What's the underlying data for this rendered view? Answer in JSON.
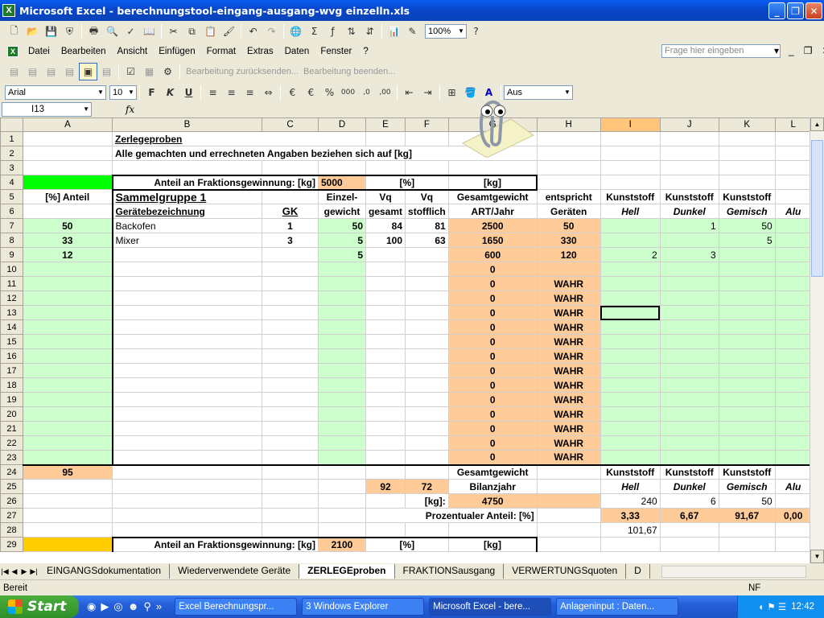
{
  "window": {
    "title": "Microsoft Excel - berechnungstool-eingang-ausgang-wvg einzelln.xls"
  },
  "menu": [
    "Datei",
    "Bearbeiten",
    "Ansicht",
    "Einfügen",
    "Format",
    "Extras",
    "Daten",
    "Fenster",
    "?"
  ],
  "help_placeholder": "Frage hier eingeben",
  "standard_toolbar": {
    "zoom": "100%",
    "icons": [
      "new-icon",
      "open-icon",
      "save-icon",
      "permission-icon",
      "print-icon",
      "print-preview-icon",
      "spelling-icon",
      "research-icon",
      "cut-icon",
      "copy-icon",
      "paste-icon",
      "format-painter-icon",
      "undo-icon",
      "redo-icon",
      "hyperlink-icon",
      "autosum-icon",
      "sort-asc-icon",
      "sort-desc-icon",
      "chart-wizard-icon",
      "drawing-icon",
      "zoom-icon",
      "help-icon"
    ]
  },
  "review_toolbar": {
    "reply_label": "Bearbeitung zurücksenden...",
    "end_label": "Bearbeitung beenden..."
  },
  "formatting_toolbar": {
    "font": "Arial",
    "size": "10",
    "border_style": "Aus"
  },
  "formula_bar": {
    "name_box": "I13",
    "fx": "fx",
    "value": ""
  },
  "columns": [
    "A",
    "B",
    "C",
    "D",
    "E",
    "F",
    "G",
    "H",
    "I",
    "J",
    "K",
    "L"
  ],
  "sheet": {
    "title": "Zerlegeproben",
    "subtitle": "Alle gemachten und errechneten Angaben beziehen sich auf [kg]",
    "r4": {
      "label": "Anteil an Fraktionsgewinnung: [kg]",
      "value": "5000",
      "pct": "[%]",
      "kg": "[kg]"
    },
    "r5": {
      "a": "[%] Anteil",
      "b": "Sammelgruppe 1",
      "d": "Einzel-",
      "e": "Vq",
      "f": "Vq",
      "g": "Gesamtgewicht",
      "h": "entspricht",
      "i": "Kunststoff",
      "j": "Kunststoff",
      "k": "Kunststoff"
    },
    "r6": {
      "b": "Gerätebezeichnung",
      "c": "GK",
      "d": "gewicht",
      "e": "gesamt",
      "f": "stofflich",
      "g": "ART/Jahr",
      "h": "Geräten",
      "i": "Hell",
      "j": "Dunkel",
      "k": "Gemisch",
      "l": "Alu"
    },
    "rows": [
      {
        "n": "7",
        "a": "50",
        "b": "Backofen",
        "c": "1",
        "d": "50",
        "e": "84",
        "f": "81",
        "g": "2500",
        "h": "50",
        "i": "",
        "j": "1",
        "k": "50"
      },
      {
        "n": "8",
        "a": "33",
        "b": "Mixer",
        "c": "3",
        "d": "5",
        "e": "100",
        "f": "63",
        "g": "1650",
        "h": "330",
        "i": "",
        "j": "",
        "k": "5"
      },
      {
        "n": "9",
        "a": "12",
        "b": "",
        "c": "",
        "d": "5",
        "e": "",
        "f": "",
        "g": "600",
        "h": "120",
        "i": "2",
        "j": "3",
        "k": ""
      },
      {
        "n": "10",
        "a": "",
        "b": "",
        "c": "",
        "d": "",
        "e": "",
        "f": "",
        "g": "0",
        "h": "",
        "i": "",
        "j": "",
        "k": ""
      },
      {
        "n": "11",
        "a": "",
        "b": "",
        "c": "",
        "d": "",
        "e": "",
        "f": "",
        "g": "0",
        "h": "WAHR",
        "i": "",
        "j": "",
        "k": ""
      },
      {
        "n": "12",
        "a": "",
        "b": "",
        "c": "",
        "d": "",
        "e": "",
        "f": "",
        "g": "0",
        "h": "WAHR",
        "i": "",
        "j": "",
        "k": ""
      },
      {
        "n": "13",
        "a": "",
        "b": "",
        "c": "",
        "d": "",
        "e": "",
        "f": "",
        "g": "0",
        "h": "WAHR",
        "i": "",
        "j": "",
        "k": ""
      },
      {
        "n": "14",
        "a": "",
        "b": "",
        "c": "",
        "d": "",
        "e": "",
        "f": "",
        "g": "0",
        "h": "WAHR",
        "i": "",
        "j": "",
        "k": ""
      },
      {
        "n": "15",
        "a": "",
        "b": "",
        "c": "",
        "d": "",
        "e": "",
        "f": "",
        "g": "0",
        "h": "WAHR",
        "i": "",
        "j": "",
        "k": ""
      },
      {
        "n": "16",
        "a": "",
        "b": "",
        "c": "",
        "d": "",
        "e": "",
        "f": "",
        "g": "0",
        "h": "WAHR",
        "i": "",
        "j": "",
        "k": ""
      },
      {
        "n": "17",
        "a": "",
        "b": "",
        "c": "",
        "d": "",
        "e": "",
        "f": "",
        "g": "0",
        "h": "WAHR",
        "i": "",
        "j": "",
        "k": ""
      },
      {
        "n": "18",
        "a": "",
        "b": "",
        "c": "",
        "d": "",
        "e": "",
        "f": "",
        "g": "0",
        "h": "WAHR",
        "i": "",
        "j": "",
        "k": ""
      },
      {
        "n": "19",
        "a": "",
        "b": "",
        "c": "",
        "d": "",
        "e": "",
        "f": "",
        "g": "0",
        "h": "WAHR",
        "i": "",
        "j": "",
        "k": ""
      },
      {
        "n": "20",
        "a": "",
        "b": "",
        "c": "",
        "d": "",
        "e": "",
        "f": "",
        "g": "0",
        "h": "WAHR",
        "i": "",
        "j": "",
        "k": ""
      },
      {
        "n": "21",
        "a": "",
        "b": "",
        "c": "",
        "d": "",
        "e": "",
        "f": "",
        "g": "0",
        "h": "WAHR",
        "i": "",
        "j": "",
        "k": ""
      },
      {
        "n": "22",
        "a": "",
        "b": "",
        "c": "",
        "d": "",
        "e": "",
        "f": "",
        "g": "0",
        "h": "WAHR",
        "i": "",
        "j": "",
        "k": ""
      },
      {
        "n": "23",
        "a": "",
        "b": "",
        "c": "",
        "d": "",
        "e": "",
        "f": "",
        "g": "0",
        "h": "WAHR",
        "i": "",
        "j": "",
        "k": ""
      }
    ],
    "r24": {
      "a": "95",
      "g": "Gesamtgewicht",
      "i": "Kunststoff",
      "j": "Kunststoff",
      "k": "Kunststoff"
    },
    "r25": {
      "e": "92",
      "f": "72",
      "g": "Bilanzjahr",
      "i": "Hell",
      "j": "Dunkel",
      "k": "Gemisch",
      "l": "Alu"
    },
    "r26": {
      "label": "[kg]:",
      "g": "4750",
      "i": "240",
      "j": "6",
      "k": "50"
    },
    "r27": {
      "label": "Prozentualer Anteil: [%]",
      "i": "3,33",
      "j": "6,67",
      "k": "91,67",
      "l": "0,00"
    },
    "r28": {
      "i": "101,67"
    },
    "r29": {
      "label": "Anteil an Fraktionsgewinnung: [kg]",
      "value": "2100",
      "pct": "[%]",
      "kg": "[kg]"
    }
  },
  "tabs": [
    "EINGANGSdokumentation",
    "Wiederverwendete Geräte",
    "ZERLEGEproben",
    "FRAKTIONSausgang",
    "VERWERTUNGSquoten",
    "D"
  ],
  "status": {
    "left": "Bereit",
    "right": "NF"
  },
  "taskbar": {
    "start": "Start",
    "tasks": [
      "Excel Berechnungspr...",
      "3 Windows Explorer",
      "Microsoft Excel - bere...",
      "Anlageninput : Daten..."
    ],
    "clock": "12:42"
  },
  "colors": {
    "titlebar": "#0a5cf0",
    "green_fill": "#ccffcc",
    "orange_fill": "#ffcc99",
    "bright_green": "#00ff00",
    "yellow": "#ffcc00"
  }
}
